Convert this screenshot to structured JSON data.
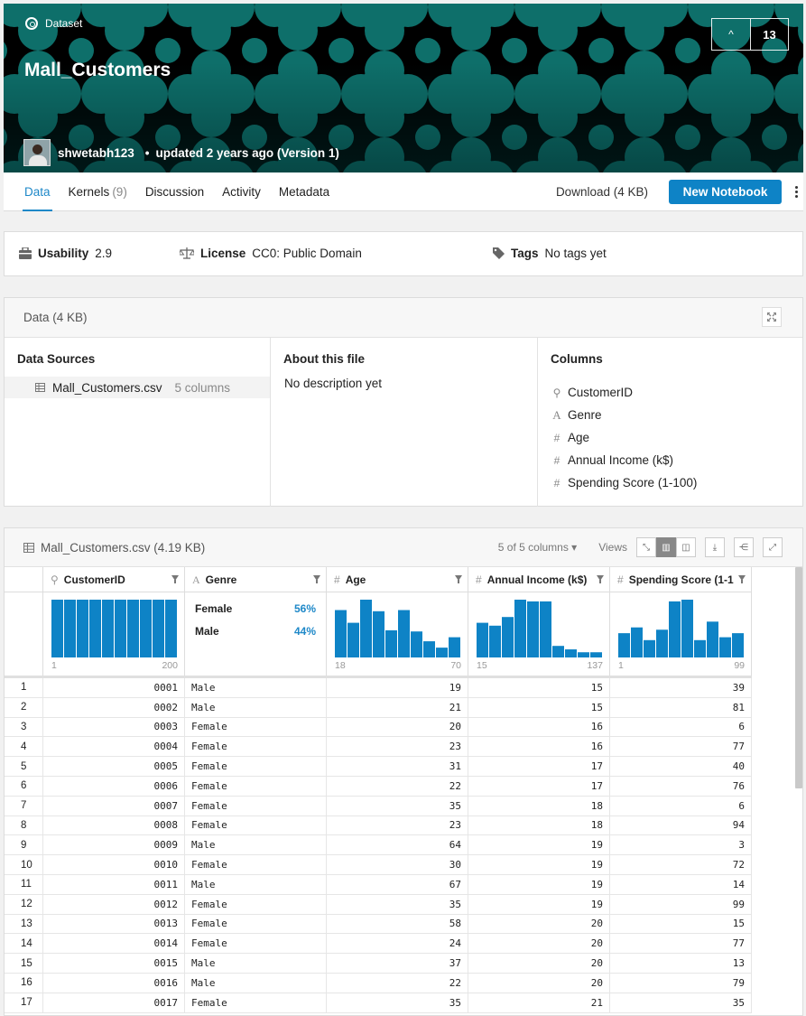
{
  "header": {
    "type_label": "Dataset",
    "title": "Mall_Customers",
    "vote_count": "13",
    "author": "shwetabh123",
    "updated_text": "updated 2 years ago (Version 1)",
    "bg_color": "#0e6f6a"
  },
  "tabs": [
    {
      "label": "Data",
      "count": ""
    },
    {
      "label": "Kernels",
      "count": "(9)"
    },
    {
      "label": "Discussion",
      "count": ""
    },
    {
      "label": "Activity",
      "count": ""
    },
    {
      "label": "Metadata",
      "count": ""
    }
  ],
  "actions": {
    "download_label": "Download (4 KB)",
    "new_notebook_label": "New Notebook",
    "accent": "#0e83c6"
  },
  "info": {
    "usability_label": "Usability",
    "usability_value": "2.9",
    "license_label": "License",
    "license_value": "CC0: Public Domain",
    "tags_label": "Tags",
    "tags_value": "No tags yet"
  },
  "data_panel": {
    "title": "Data (4 KB)",
    "sources_title": "Data Sources",
    "source_file": "Mall_Customers.csv",
    "source_cols": "5 columns",
    "about_title": "About this file",
    "about_text": "No description yet",
    "columns_title": "Columns",
    "columns": [
      {
        "icon": "key-icon",
        "name": "CustomerID"
      },
      {
        "icon": "text-type-icon",
        "name": "Genre"
      },
      {
        "icon": "hash-icon",
        "name": "Age"
      },
      {
        "icon": "hash-icon",
        "name": "Annual Income (k$)"
      },
      {
        "icon": "hash-icon",
        "name": "Spending Score (1-100)"
      }
    ]
  },
  "file_panel": {
    "title": "Mall_Customers.csv (4.19 KB)",
    "columns_select": "5 of 5 columns",
    "views_label": "Views"
  },
  "table": {
    "headers": [
      "CustomerID",
      "Genre",
      "Age",
      "Annual Income (k$)",
      "Spending Score (1-1"
    ],
    "summaries": [
      {
        "min": "1",
        "max": "200",
        "bins": [
          1,
          1,
          1,
          1,
          1,
          1,
          1,
          1,
          1,
          1
        ]
      },
      {
        "categories": [
          {
            "label": "Female",
            "pct": "56%"
          },
          {
            "label": "Male",
            "pct": "44%"
          }
        ]
      },
      {
        "min": "18",
        "max": "70",
        "bins": [
          0.82,
          0.6,
          1,
          0.8,
          0.47,
          0.82,
          0.45,
          0.28,
          0.17,
          0.35
        ]
      },
      {
        "min": "15",
        "max": "137",
        "bins": [
          0.6,
          0.55,
          0.7,
          1,
          0.97,
          0.97,
          0.2,
          0.14,
          0.09,
          0.09
        ]
      },
      {
        "min": "1",
        "max": "99",
        "bins": [
          0.42,
          0.52,
          0.3,
          0.48,
          0.97,
          1,
          0.3,
          0.62,
          0.35,
          0.42
        ]
      }
    ],
    "rows": [
      [
        "1",
        "0001",
        "Male",
        "19",
        "15",
        "39"
      ],
      [
        "2",
        "0002",
        "Male",
        "21",
        "15",
        "81"
      ],
      [
        "3",
        "0003",
        "Female",
        "20",
        "16",
        "6"
      ],
      [
        "4",
        "0004",
        "Female",
        "23",
        "16",
        "77"
      ],
      [
        "5",
        "0005",
        "Female",
        "31",
        "17",
        "40"
      ],
      [
        "6",
        "0006",
        "Female",
        "22",
        "17",
        "76"
      ],
      [
        "7",
        "0007",
        "Female",
        "35",
        "18",
        "6"
      ],
      [
        "8",
        "0008",
        "Female",
        "23",
        "18",
        "94"
      ],
      [
        "9",
        "0009",
        "Male",
        "64",
        "19",
        "3"
      ],
      [
        "10",
        "0010",
        "Female",
        "30",
        "19",
        "72"
      ],
      [
        "11",
        "0011",
        "Male",
        "67",
        "19",
        "14"
      ],
      [
        "12",
        "0012",
        "Female",
        "35",
        "19",
        "99"
      ],
      [
        "13",
        "0013",
        "Female",
        "58",
        "20",
        "15"
      ],
      [
        "14",
        "0014",
        "Female",
        "24",
        "20",
        "77"
      ],
      [
        "15",
        "0015",
        "Male",
        "37",
        "20",
        "13"
      ],
      [
        "16",
        "0016",
        "Male",
        "22",
        "20",
        "79"
      ],
      [
        "17",
        "0017",
        "Female",
        "35",
        "21",
        "35"
      ]
    ],
    "bar_color": "#0e83c6"
  }
}
